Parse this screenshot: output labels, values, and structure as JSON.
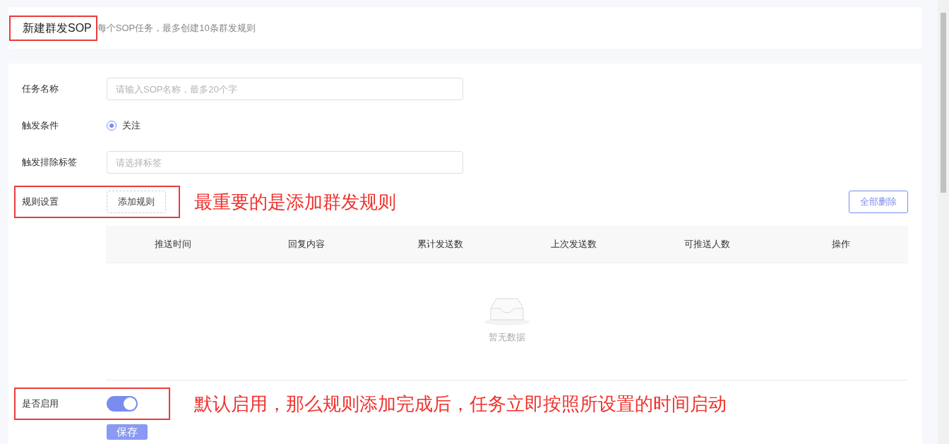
{
  "header": {
    "title": "新建群发SOP",
    "subtitle": "每个SOP任务，最多创建10条群发规则",
    "highlighted": true
  },
  "form": {
    "name_field": {
      "label": "任务名称",
      "placeholder": "请输入SOP名称，最多20个字"
    },
    "trigger": {
      "label": "触发条件",
      "options": [
        {
          "label": "关注",
          "selected": true
        }
      ]
    },
    "exclude_tags": {
      "label": "触发排除标签",
      "placeholder": "请选择标签"
    },
    "rules": {
      "label": "规则设置",
      "add_button": "添加规则",
      "delete_all_button": "全部删除",
      "highlighted": true,
      "annotation": "最重要的是添加群发规则"
    },
    "table": {
      "columns": [
        "推送时间",
        "回复内容",
        "累计发送数",
        "上次发送数",
        "可推送人数",
        "操作"
      ],
      "empty_text": "暂无数据"
    },
    "enable": {
      "label": "是否启用",
      "on": true,
      "highlighted": true,
      "annotation": "默认启用，那么规则添加完成后，任务立即按照所设置的时间启动"
    },
    "save_button": "保存"
  }
}
